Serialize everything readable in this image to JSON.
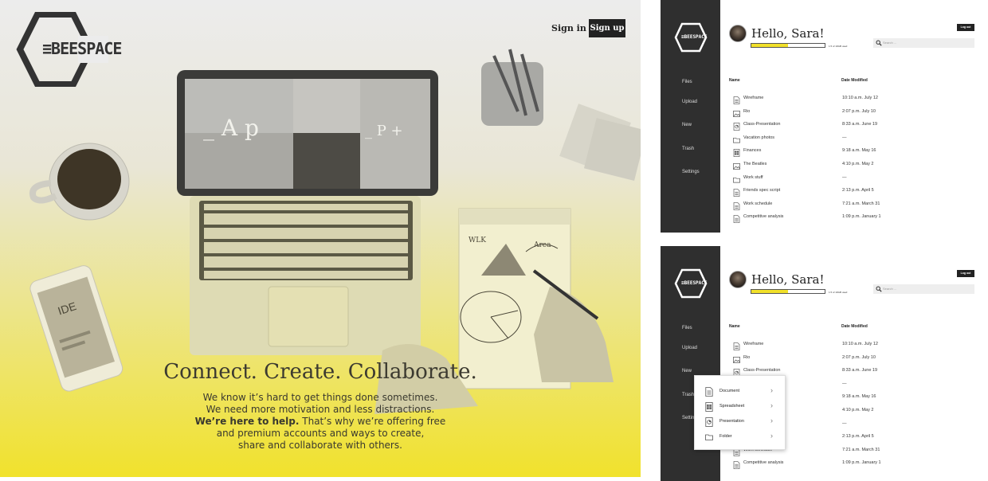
{
  "landing": {
    "brand": "≡BEESPACE",
    "signin_label": "Sign in",
    "signup_label": "Sign up",
    "headline": "Connect. Create. Collaborate.",
    "body_line1": "We know it’s hard to get things done sometimes.",
    "body_line2": "We need more motivation and less distractions.",
    "body_line3_bold": "We’re here to help.",
    "body_line3_rest": " That’s why we’re offering free",
    "body_line4": "and premium accounts and ways to create,",
    "body_line5": "share and collaborate with others.",
    "screen_text_left": "_ A p",
    "screen_text_right": "_ P +",
    "phone_text": "IDE",
    "sketch_text1": "WLK",
    "sketch_text2": "Area"
  },
  "app": {
    "brand": "≡BEESPACE",
    "greeting": "Hello, Sara!",
    "storage_text": "1.5 of 10GB used",
    "storage_fraction": 0.5,
    "logout_label": "Log out",
    "search_placeholder": "Search ...",
    "nav": [
      "Files",
      "Upload",
      "New",
      "Trash",
      "Settings"
    ],
    "col_name": "Name",
    "col_date": "Date Modified",
    "files": [
      {
        "name": "Wireframe",
        "date": "10:10 a.m. July 12",
        "icon": "document-icon"
      },
      {
        "name": "Rio",
        "date": "2:07 p.m. July 10",
        "icon": "image-icon"
      },
      {
        "name": "Class-Presentation",
        "date": "8:33 a.m. June 19",
        "icon": "presentation-icon"
      },
      {
        "name": "Vacation photos",
        "date": "—",
        "icon": "folder-icon"
      },
      {
        "name": "Finances",
        "date": "9:18 a.m. May 16",
        "icon": "spreadsheet-icon"
      },
      {
        "name": "The Beatles",
        "date": "4:10 p.m. May 2",
        "icon": "image-icon"
      },
      {
        "name": "Work stuff",
        "date": "—",
        "icon": "folder-icon"
      },
      {
        "name": "Friends spec script",
        "date": "2:13 p.m. April 5",
        "icon": "document-icon"
      },
      {
        "name": "Work schedule",
        "date": "7:21 a.m. March 31",
        "icon": "document-icon"
      },
      {
        "name": "Competitive analysis",
        "date": "1:09 p.m. January 1",
        "icon": "document-icon"
      }
    ],
    "new_menu": [
      {
        "label": "Document",
        "icon": "document-icon"
      },
      {
        "label": "Spreadsheet",
        "icon": "spreadsheet-icon"
      },
      {
        "label": "Presentation",
        "icon": "presentation-icon"
      },
      {
        "label": "Folder",
        "icon": "folder-icon"
      }
    ],
    "chevron": "›"
  }
}
